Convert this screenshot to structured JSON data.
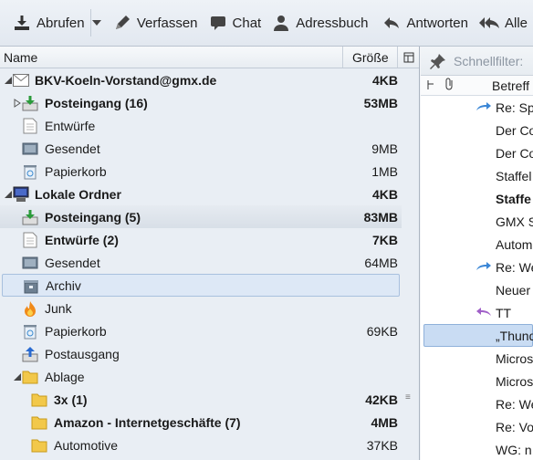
{
  "toolbar": {
    "get_messages": "Abrufen",
    "compose": "Verfassen",
    "chat": "Chat",
    "address_book": "Adressbuch",
    "reply": "Antworten",
    "reply_all": "Alle"
  },
  "folder_pane": {
    "columns": {
      "name": "Name",
      "size": "Größe"
    },
    "rows": [
      {
        "label": "BKV-Koeln-Vorstand@gmx.de",
        "size": "4KB",
        "icon": "envelope-icon",
        "bold": true
      },
      {
        "label": "Posteingang (16)",
        "size": "53MB",
        "icon": "inbox-icon",
        "bold": true
      },
      {
        "label": "Entwürfe",
        "size": "",
        "icon": "drafts-icon",
        "bold": false
      },
      {
        "label": "Gesendet",
        "size": "9MB",
        "icon": "sent-icon",
        "bold": false
      },
      {
        "label": "Papierkorb",
        "size": "1MB",
        "icon": "trash-icon",
        "bold": false
      },
      {
        "label": "Lokale Ordner",
        "size": "4KB",
        "icon": "computer-icon",
        "bold": true
      },
      {
        "label": "Posteingang (5)",
        "size": "83MB",
        "icon": "inbox-icon",
        "bold": true
      },
      {
        "label": "Entwürfe (2)",
        "size": "7KB",
        "icon": "drafts-icon",
        "bold": true
      },
      {
        "label": "Gesendet",
        "size": "64MB",
        "icon": "sent-icon",
        "bold": false
      },
      {
        "label": "Archiv",
        "size": "",
        "icon": "archive-icon",
        "bold": false
      },
      {
        "label": "Junk",
        "size": "",
        "icon": "junk-fire-icon",
        "bold": false
      },
      {
        "label": "Papierkorb",
        "size": "69KB",
        "icon": "trash-icon",
        "bold": false
      },
      {
        "label": "Postausgang",
        "size": "",
        "icon": "outbox-icon",
        "bold": false
      },
      {
        "label": "Ablage",
        "size": "",
        "icon": "folder-icon",
        "bold": false
      },
      {
        "label": "3x (1)",
        "size": "42KB",
        "icon": "folder-icon",
        "bold": true
      },
      {
        "label": "Amazon - Internetgeschäfte (7)",
        "size": "4MB",
        "icon": "folder-icon",
        "bold": true
      },
      {
        "label": "Automotive",
        "size": "37KB",
        "icon": "folder-icon",
        "bold": false
      }
    ]
  },
  "message_pane": {
    "quick_filter_placeholder": "Schnellfilter:",
    "subject_header": "Betreff",
    "messages": [
      {
        "subject": "Re: Sp",
        "icon": "forwarded-icon",
        "bold": false
      },
      {
        "subject": "Der Co",
        "icon": "",
        "bold": false
      },
      {
        "subject": "Der Co",
        "icon": "",
        "bold": false
      },
      {
        "subject": "Staffel",
        "icon": "",
        "bold": false
      },
      {
        "subject": "Staffe",
        "icon": "",
        "bold": true
      },
      {
        "subject": "GMX S",
        "icon": "",
        "bold": false
      },
      {
        "subject": "Autom",
        "icon": "",
        "bold": false
      },
      {
        "subject": "Re: We",
        "icon": "forwarded-icon",
        "bold": false
      },
      {
        "subject": "Neuer",
        "icon": "",
        "bold": false
      },
      {
        "subject": "TT",
        "icon": "replied-icon",
        "bold": false
      },
      {
        "subject": "„Thund",
        "icon": "",
        "bold": false
      },
      {
        "subject": "Micros",
        "icon": "",
        "bold": false
      },
      {
        "subject": "Micros",
        "icon": "",
        "bold": false
      },
      {
        "subject": "Re: We",
        "icon": "",
        "bold": false
      },
      {
        "subject": "Re: Vo",
        "icon": "",
        "bold": false
      },
      {
        "subject": "WG: n",
        "icon": "",
        "bold": false
      }
    ]
  },
  "colors": {
    "toolbar_bg": "#e6ecf3",
    "pane_bg": "#e9eef4",
    "selection": "#c9dcf3",
    "forward_arrow": "#3a86d6",
    "reply_arrow": "#a060c8"
  }
}
